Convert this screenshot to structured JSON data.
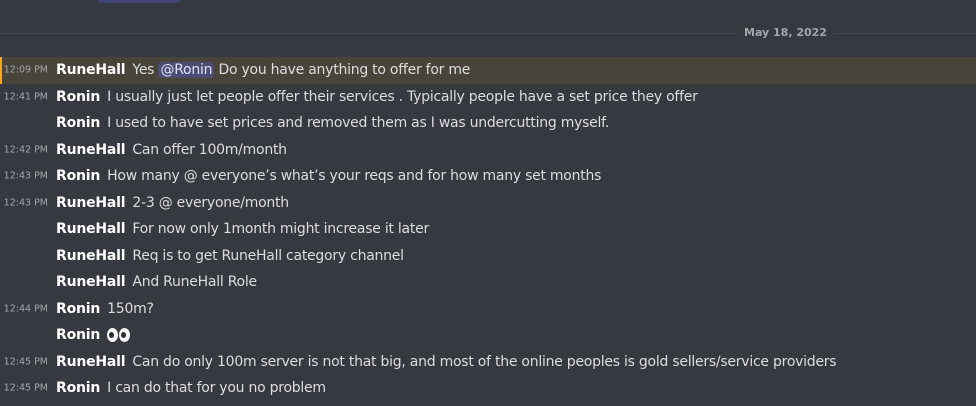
{
  "date_divider": "May 18, 2022",
  "messages": [
    {
      "time": "12:09 PM",
      "author": "RuneHall",
      "pre": "Yes",
      "mention": "@Ronin",
      "post": "Do you have anything to offer for me",
      "highlight": true
    },
    {
      "time": "12:41 PM",
      "author": "Ronin",
      "text": "I usually just let people offer  their services . Typically people have a set price they offer"
    },
    {
      "time": "",
      "author": "Ronin",
      "text": "I used to have set prices and removed them as I was undercutting myself."
    },
    {
      "time": "12:42 PM",
      "author": "RuneHall",
      "text": "Can offer 100m/month"
    },
    {
      "time": "12:43 PM",
      "author": "Ronin",
      "text": "How many @ everyone’s what’s your reqs and for how many set months"
    },
    {
      "time": "12:43 PM",
      "author": "RuneHall",
      "text": "2-3 @ everyone/month"
    },
    {
      "time": "",
      "author": "RuneHall",
      "text": "For now only 1month might increase it later"
    },
    {
      "time": "",
      "author": "RuneHall",
      "text": "Req is to get RuneHall category channel"
    },
    {
      "time": "",
      "author": "RuneHall",
      "text": "And RuneHall Role"
    },
    {
      "time": "12:44 PM",
      "author": "Ronin",
      "text": "150m?"
    },
    {
      "time": "",
      "author": "Ronin",
      "emoji": "eyes-emoji"
    },
    {
      "time": "12:45 PM",
      "author": "RuneHall",
      "text": "Can do only 100m server is not that big, and most of the online peoples is gold sellers/service providers"
    },
    {
      "time": "12:45 PM",
      "author": "Ronin",
      "text": "I can do that for you no problem"
    }
  ],
  "colors": {
    "background": "#36393f",
    "highlight_background": "#48443a",
    "highlight_bar": "#faa61a",
    "mention_background": "#5865f24d",
    "author": "#ffffff",
    "text": "#dcddde",
    "timestamp": "#a3a6aa"
  }
}
